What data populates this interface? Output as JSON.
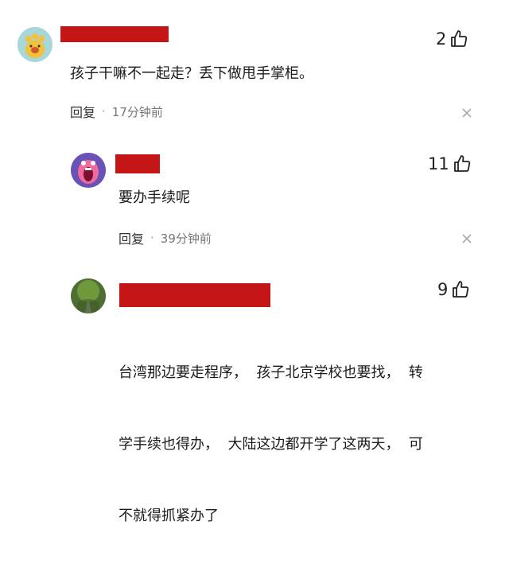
{
  "comments": [
    {
      "likes": "2",
      "text": "孩子干嘛不一起走？丢下做甩手掌柜。",
      "reply_label": "回复",
      "time": "17分钟前",
      "avatar_icon": "cartoon-face-icon"
    },
    {
      "likes": "11",
      "text": "要办手续呢",
      "reply_label": "回复",
      "time": "39分钟前",
      "avatar_icon": "screaming-face-icon"
    },
    {
      "likes": "9",
      "text_lines": [
        "台湾那边要走程序，  孩子北京学校也要找，  转",
        "学手续也得办，  大陆这边都开学了这两天，  可",
        "不就得抓紧办了"
      ],
      "avatar_icon": "road-photo-icon"
    }
  ],
  "colors": {
    "redaction": "#c41616",
    "meta": "#777777"
  }
}
